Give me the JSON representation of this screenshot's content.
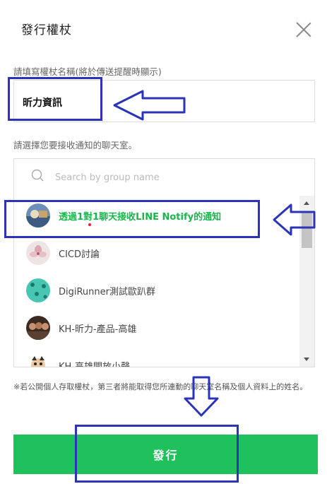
{
  "dialog": {
    "title": "發行權杖",
    "token_name_label": "請填寫權杖名稱(將於傳送提醒時顯示)",
    "token_name_value": "昕力資訊",
    "chatroom_label": "請選擇您要接收通知的聊天室。",
    "search_placeholder": "Search by group name",
    "notice": "※若公開個人存取權杖，第三者將能取得您所連動的聊天室名稱及個人資料上的姓名。",
    "issue_button": "發行"
  },
  "chatrooms": [
    {
      "label": "透過1對1聊天接收LINE Notify的通知",
      "selected": true,
      "avatar": "landscape-avatar"
    },
    {
      "label": "CICD討論",
      "selected": false,
      "avatar": "flower-avatar"
    },
    {
      "label": "DigiRunner測試歐趴群",
      "selected": false,
      "avatar": "pattern-avatar"
    },
    {
      "label": "KH-昕力-產品-高雄",
      "selected": false,
      "avatar": "group-photo-avatar"
    },
    {
      "label": "KH-高雄開放小聲",
      "selected": false,
      "avatar": "character-avatar"
    }
  ],
  "colors": {
    "accent_green": "#1ec15b",
    "selected_text": "#16b84a",
    "annotation_blue": "#2b34b8"
  }
}
